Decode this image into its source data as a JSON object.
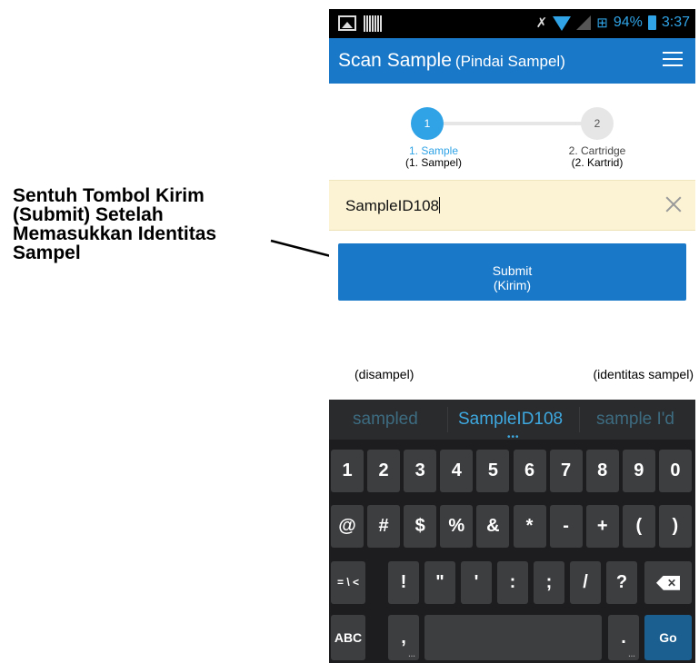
{
  "annotation": {
    "lines": [
      "Sentuh Tombol Kirim",
      "(Submit) Setelah",
      "Memasukkan Identitas",
      "Sampel"
    ]
  },
  "statusbar": {
    "battery": "94%",
    "time": "3:37"
  },
  "appbar": {
    "title": "Scan Sample",
    "subtitle": "(Pindai Sampel)"
  },
  "stepper": {
    "step1_number": "1",
    "step1_label": "1. Sample",
    "step1_label_id": "(1. Sampel)",
    "step2_number": "2",
    "step2_label": "2. Cartridge",
    "step2_label_id": "(2. Kartrid)"
  },
  "input": {
    "value": "SampleID108"
  },
  "submit": {
    "label": "Submit",
    "label_id": "(Kirim)"
  },
  "notes": {
    "left": "(disampel)",
    "right": "(identitas sampel)"
  },
  "keyboard": {
    "suggestions": [
      "sampled",
      "SampleID108",
      "sample I'd"
    ],
    "row1": [
      "1",
      "2",
      "3",
      "4",
      "5",
      "6",
      "7",
      "8",
      "9",
      "0"
    ],
    "row2": [
      "@",
      "#",
      "$",
      "%",
      "&",
      "*",
      "-",
      "+",
      "(",
      ")"
    ],
    "row3": [
      "= \\ <",
      "!",
      "\"",
      "'",
      ":",
      ";",
      "/",
      "?"
    ],
    "row4": {
      "abc": "ABC",
      "comma": ",",
      "period": ".",
      "go": "Go"
    }
  },
  "colors": {
    "primary": "#1a78c8",
    "accent": "#2fa3e6",
    "input_bg": "#fbf3d3"
  }
}
